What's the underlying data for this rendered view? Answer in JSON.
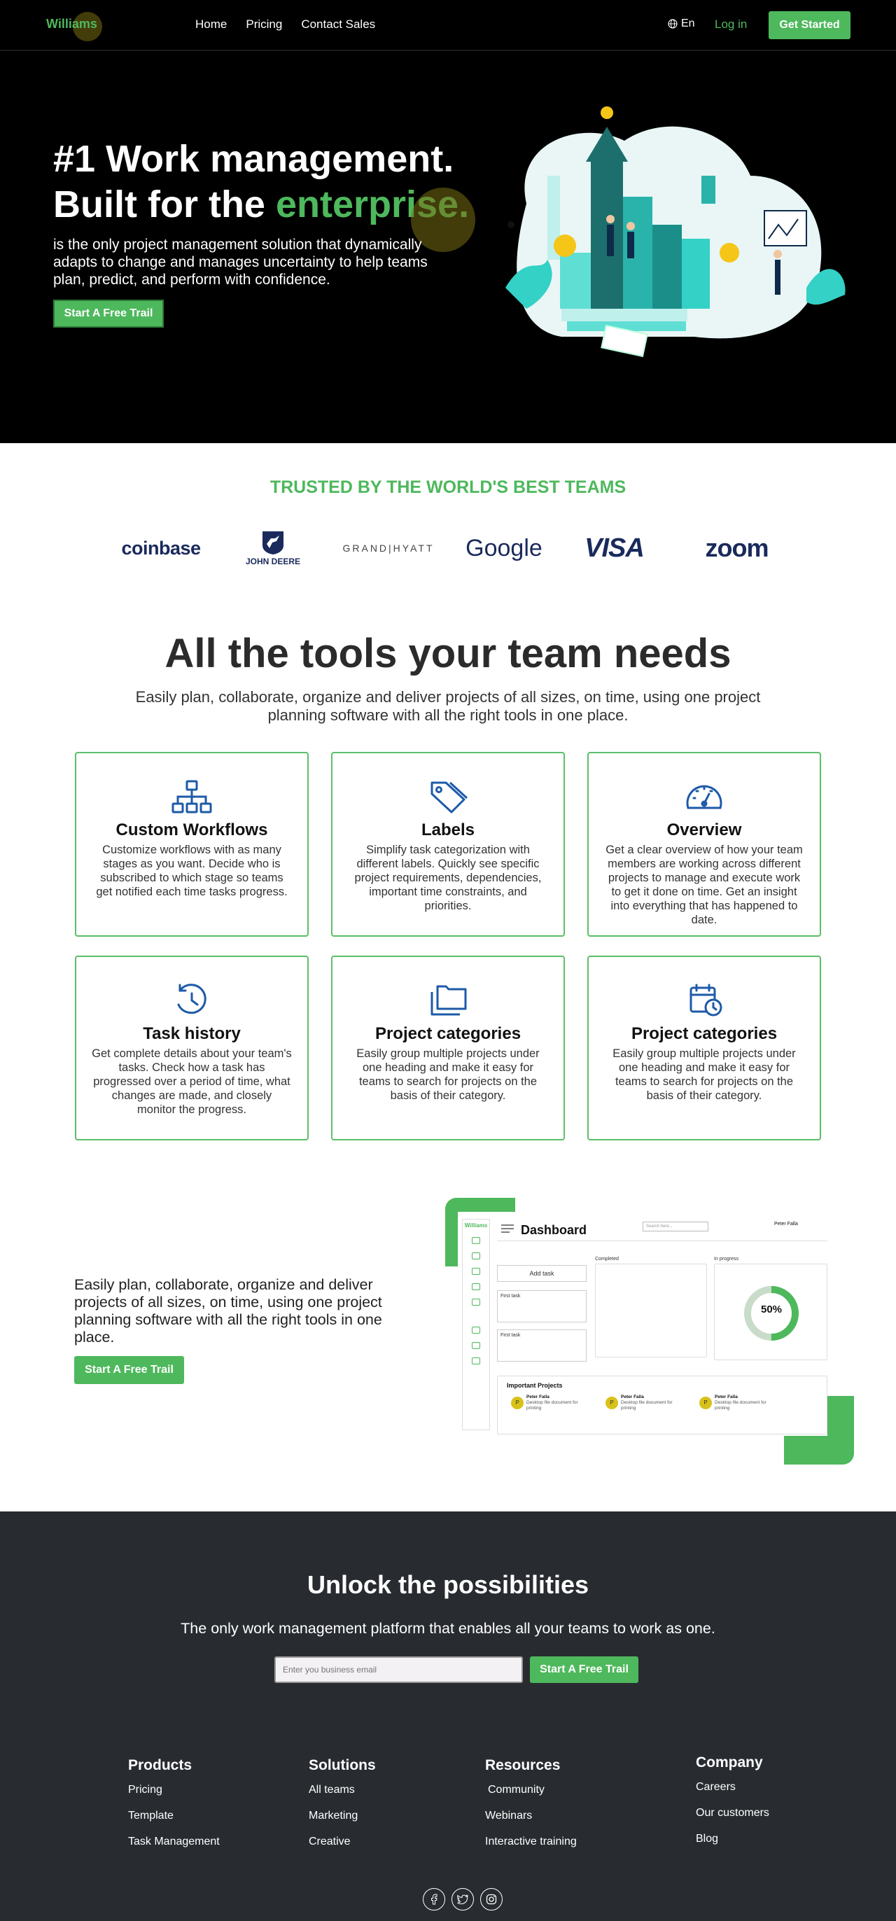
{
  "nav": {
    "logo": "Williams",
    "links": [
      "Home",
      "Pricing",
      "Contact Sales"
    ],
    "language": "En",
    "login": "Log in",
    "get_started": "Get Started"
  },
  "hero": {
    "title_line1": "#1 Work management.",
    "title_line2_prefix": "Built for the ",
    "title_line2_accent": "enterprise.",
    "description": "is the only project management solution that dynamically adapts to change and manages uncertainty to help teams plan, predict, and perform with confidence.",
    "cta": "Start A Free Trail"
  },
  "trusted": {
    "title": "TRUSTED BY THE WORLD'S BEST TEAMS",
    "brands": [
      "coinbase",
      "JOHN DEERE",
      "GRAND|HYATT",
      "Google",
      "VISA",
      "zoom"
    ]
  },
  "tools": {
    "title": "All the tools your team needs",
    "subtitle": "Easily plan, collaborate, organize and deliver projects of all sizes, on time, using one project planning software with all the right tools in one place.",
    "cards": [
      {
        "icon": "hierarchy-icon",
        "title": "Custom Workflows",
        "text": "Customize workflows with as many stages as you want. Decide who is subscribed to which stage so teams get notified each time tasks progress."
      },
      {
        "icon": "tags-icon",
        "title": "Labels",
        "text": "Simplify task categorization with different labels. Quickly see specific project requirements, dependencies, important time constraints, and priorities."
      },
      {
        "icon": "gauge-icon",
        "title": "Overview",
        "text": "Get a clear overview of how your team members are working across different projects to manage and execute work to get it done on time. Get an insight into everything that has happened to date."
      },
      {
        "icon": "history-icon",
        "title": "Task history",
        "text": "Get complete details about your team's tasks. Check how a task has progressed over a period of time, what changes are made, and closely monitor the progress."
      },
      {
        "icon": "folders-icon",
        "title": "Project categories",
        "text": "Easily group multiple projects under one heading and make it easy for teams to search for projects on the basis of their category."
      },
      {
        "icon": "calendar-clock-icon",
        "title": "Project categories",
        "text": "Easily group multiple projects under one heading and make it easy for teams to search for projects on the basis of their category."
      }
    ]
  },
  "dashboard_section": {
    "text": "Easily plan, collaborate, organize and deliver projects of all sizes, on time, using one project planning software with all the right tools in one place.",
    "cta": "Start A Free Trail",
    "mock": {
      "brand": "Williams",
      "title": "Dashboard",
      "search_placeholder": "Search here...",
      "user": "Peter Falla",
      "add_task": "Add task",
      "columns": [
        "Completed",
        "In progress"
      ],
      "tasks": [
        "First task",
        "First task"
      ],
      "progress": 0.5,
      "progress_label": "50%",
      "important_title": "Important Projects",
      "important": [
        {
          "initial": "P",
          "name": "Peter Falla",
          "desc": "Desktop file document for printing"
        },
        {
          "initial": "P",
          "name": "Peter Falla",
          "desc": "Desktop file document for printing"
        },
        {
          "initial": "P",
          "name": "Peter Falla",
          "desc": "Desktop file document for printing"
        }
      ]
    }
  },
  "unlock": {
    "title": "Unlock the possibilities",
    "subtitle": "The only work management platform that enables all your teams to work as one.",
    "email_placeholder": "Enter you business email",
    "cta": "Start A Free Trail"
  },
  "footer": {
    "columns": [
      {
        "title": "Products",
        "links": [
          "Pricing",
          "Template",
          "Task Management"
        ]
      },
      {
        "title": "Solutions",
        "links": [
          "All teams",
          "Marketing",
          "Creative"
        ]
      },
      {
        "title": "Resources",
        "links": [
          "Community",
          "Webinars",
          "Interactive training"
        ]
      },
      {
        "title": "Company",
        "links": [
          "Careers",
          "Our customers",
          "Blog"
        ]
      }
    ],
    "social": [
      "facebook-icon",
      "twitter-icon",
      "instagram-icon"
    ]
  },
  "colors": {
    "accent": "#4eb85c",
    "dark_bg": "#282c31",
    "hero_bg": "#000000",
    "icon_blue": "#1d5aa8"
  }
}
